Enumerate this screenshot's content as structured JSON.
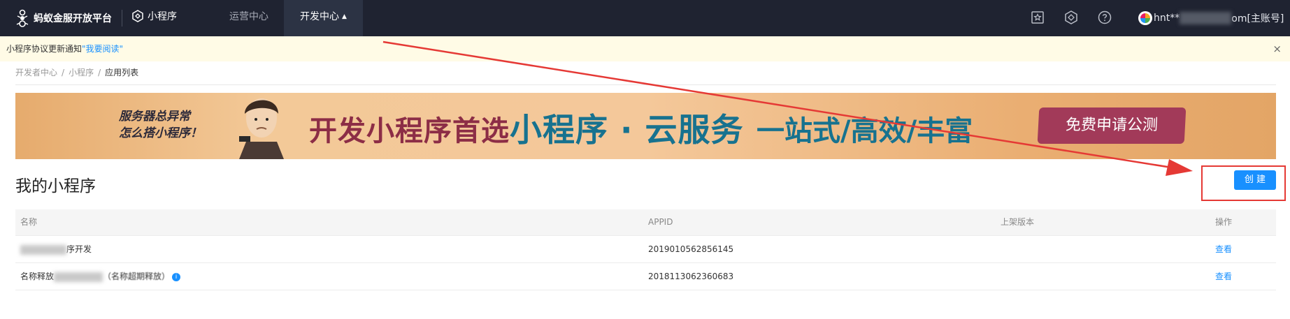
{
  "topbar": {
    "brand": "蚂蚁金服开放平台",
    "product": "小程序",
    "nav": [
      {
        "label": "运营中心"
      },
      {
        "label": "开发中心"
      }
    ],
    "account_prefix": "hnt**",
    "account_suffix": "om[主账号]",
    "icons": [
      "favorites-icon",
      "cube-icon",
      "help-icon"
    ]
  },
  "notice": {
    "text": "小程序协议更新通知",
    "link": "\"我要阅读\"",
    "close": "×"
  },
  "breadcrumb": {
    "items": [
      "开发者中心",
      "小程序",
      "应用列表"
    ],
    "separator": "/"
  },
  "banner": {
    "side_line1": "服务器总异常",
    "side_line2": "怎么搭小程序！",
    "headline": "开发小程序首选",
    "highlight": "小程序 · 云服务",
    "tagline": "一站式/高效/丰富",
    "cta": "免费申请公测"
  },
  "page": {
    "title": "我的小程序",
    "create_label": "创 建"
  },
  "table": {
    "columns": [
      "名称",
      "APPID",
      "上架版本",
      "操作"
    ],
    "rows": [
      {
        "name": "序开发",
        "appid": "2019010562856145",
        "version": "",
        "action": "查看"
      },
      {
        "name_prefix": "名称释放",
        "name": "（名称超期释放）",
        "appid": "2018113062360683",
        "version": "",
        "action": "查看",
        "info": "i"
      }
    ]
  },
  "colors": {
    "topbar_bg": "#1f2331",
    "primary": "#1890ff",
    "notice_bg": "#fffbe6",
    "annotation": "#e53935"
  }
}
